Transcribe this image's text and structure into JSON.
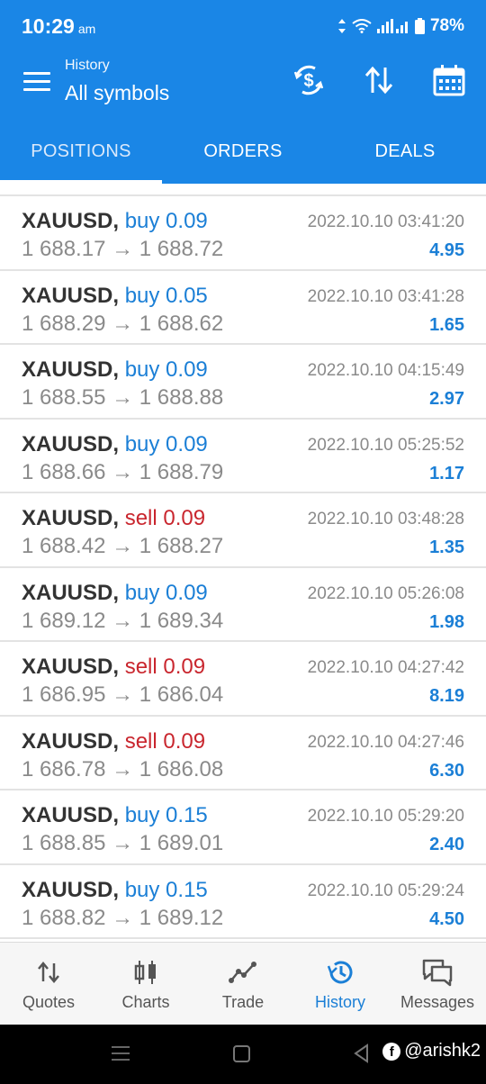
{
  "status_bar": {
    "time": "10:29",
    "ampm": "am",
    "battery": "78%"
  },
  "header": {
    "subtitle": "History",
    "title": "All symbols"
  },
  "tabs": [
    {
      "label": "POSITIONS",
      "active": true
    },
    {
      "label": "ORDERS",
      "active": false
    },
    {
      "label": "DEALS",
      "active": false
    }
  ],
  "deals": [
    {
      "symbol": "XAUUSD,",
      "side": "buy",
      "volume": "buy 0.09",
      "open": "1 688.17",
      "close": "1 688.72",
      "arrow": "→",
      "time": "2022.10.10 03:41:20",
      "profit": "4.95"
    },
    {
      "symbol": "XAUUSD,",
      "side": "buy",
      "volume": "buy 0.05",
      "open": "1 688.29",
      "close": "1 688.62",
      "arrow": "→",
      "time": "2022.10.10 03:41:28",
      "profit": "1.65"
    },
    {
      "symbol": "XAUUSD,",
      "side": "buy",
      "volume": "buy 0.09",
      "open": "1 688.55",
      "close": "1 688.88",
      "arrow": "→",
      "time": "2022.10.10 04:15:49",
      "profit": "2.97"
    },
    {
      "symbol": "XAUUSD,",
      "side": "buy",
      "volume": "buy 0.09",
      "open": "1 688.66",
      "close": "1 688.79",
      "arrow": "→",
      "time": "2022.10.10 05:25:52",
      "profit": "1.17"
    },
    {
      "symbol": "XAUUSD,",
      "side": "sell",
      "volume": "sell 0.09",
      "open": "1 688.42",
      "close": "1 688.27",
      "arrow": "→",
      "time": "2022.10.10 03:48:28",
      "profit": "1.35"
    },
    {
      "symbol": "XAUUSD,",
      "side": "buy",
      "volume": "buy 0.09",
      "open": "1 689.12",
      "close": "1 689.34",
      "arrow": "→",
      "time": "2022.10.10 05:26:08",
      "profit": "1.98"
    },
    {
      "symbol": "XAUUSD,",
      "side": "sell",
      "volume": "sell 0.09",
      "open": "1 686.95",
      "close": "1 686.04",
      "arrow": "→",
      "time": "2022.10.10 04:27:42",
      "profit": "8.19"
    },
    {
      "symbol": "XAUUSD,",
      "side": "sell",
      "volume": "sell 0.09",
      "open": "1 686.78",
      "close": "1 686.08",
      "arrow": "→",
      "time": "2022.10.10 04:27:46",
      "profit": "6.30"
    },
    {
      "symbol": "XAUUSD,",
      "side": "buy",
      "volume": "buy 0.15",
      "open": "1 688.85",
      "close": "1 689.01",
      "arrow": "→",
      "time": "2022.10.10 05:29:20",
      "profit": "2.40"
    },
    {
      "symbol": "XAUUSD,",
      "side": "buy",
      "volume": "buy 0.15",
      "open": "1 688.82",
      "close": "1 689.12",
      "arrow": "→",
      "time": "2022.10.10 05:29:24",
      "profit": "4.50"
    }
  ],
  "bottom_nav": [
    {
      "label": "Quotes",
      "icon": "quotes-icon",
      "active": false
    },
    {
      "label": "Charts",
      "icon": "charts-icon",
      "active": false
    },
    {
      "label": "Trade",
      "icon": "trade-icon",
      "active": false
    },
    {
      "label": "History",
      "icon": "history-icon",
      "active": true
    },
    {
      "label": "Messages",
      "icon": "messages-icon",
      "active": false
    }
  ],
  "watermark": {
    "handle": "@arishk2"
  },
  "colors": {
    "primary": "#1a86e6",
    "buy": "#1b7fd6",
    "sell": "#c9262e",
    "muted": "#8a8a8a"
  }
}
